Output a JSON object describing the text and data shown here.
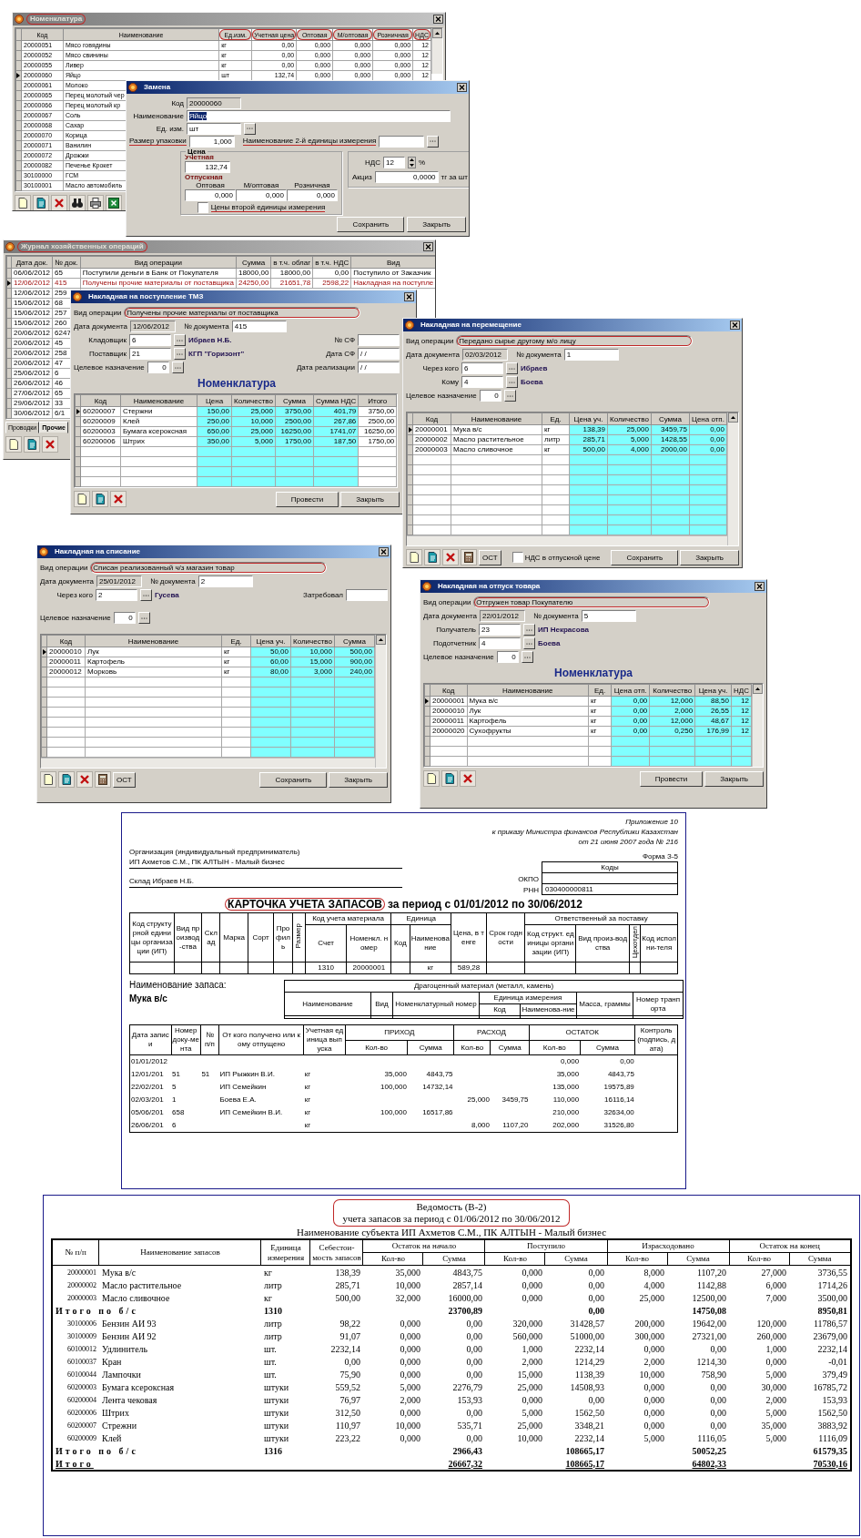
{
  "windows": [
    {
      "kind": "catalog",
      "title": "Номенклатура",
      "title_circled": true,
      "active": false,
      "table": {
        "columns": [
          {
            "label": "Код"
          },
          {
            "label": "Наименование"
          },
          {
            "label": "Ед.изм.",
            "circled": true
          },
          {
            "label": "Учетная цена",
            "circled": true
          },
          {
            "label": "Оптовая",
            "circled": true
          },
          {
            "label": "М/оптовая",
            "circled": true
          },
          {
            "label": "Розничная",
            "circled": true
          },
          {
            "label": "НДС",
            "circled": true
          }
        ],
        "rows": [
          {
            "selected": false,
            "cells": [
              "20000051",
              "Мясо говядины",
              "кг",
              "0,00",
              "0,000",
              "0,000",
              "0,000",
              "12"
            ]
          },
          {
            "selected": false,
            "cells": [
              "20000052",
              "Мясо свинины",
              "кг",
              "0,00",
              "0,000",
              "0,000",
              "0,000",
              "12"
            ]
          },
          {
            "selected": false,
            "cells": [
              "20000055",
              "Ливер",
              "кг",
              "0,00",
              "0,000",
              "0,000",
              "0,000",
              "12"
            ]
          },
          {
            "selected": true,
            "cells": [
              "20000060",
              "Яйцо",
              "шт",
              "132,74",
              "0,000",
              "0,000",
              "0,000",
              "12"
            ]
          },
          {
            "selected": false,
            "cells": [
              "20000061",
              "Молоко"
            ]
          },
          {
            "selected": false,
            "cells": [
              "20000065",
              "Перец молотый чер"
            ]
          },
          {
            "selected": false,
            "cells": [
              "20000066",
              "Перец молотый кр"
            ]
          },
          {
            "selected": false,
            "cells": [
              "20000067",
              "Соль"
            ]
          },
          {
            "selected": false,
            "cells": [
              "20000068",
              "Сахар"
            ]
          },
          {
            "selected": false,
            "cells": [
              "20000070",
              "Корица"
            ]
          },
          {
            "selected": false,
            "cells": [
              "20000071",
              "Ванилин"
            ]
          },
          {
            "selected": false,
            "cells": [
              "20000072",
              "Дрожжи"
            ]
          },
          {
            "selected": false,
            "cells": [
              "20000082",
              "Печенье Крокет"
            ]
          },
          {
            "selected": false,
            "cells": [
              "30100000",
              "ГСМ"
            ]
          },
          {
            "selected": false,
            "cells": [
              "30100001",
              "Масло автомобиль"
            ]
          }
        ]
      }
    },
    {
      "kind": "replace",
      "title": "Замена",
      "active": true,
      "code": {
        "label": "Код",
        "value": "20000060",
        "disabled": true
      },
      "name": {
        "label": "Наименование",
        "value": "Яйцо",
        "text_selected": true
      },
      "unit": {
        "label": "Ед. изм.",
        "value": "шт"
      },
      "pack": {
        "label": "Размер упаковки",
        "value": "1,000",
        "underlined": true
      },
      "unit2": {
        "label": "Наименование 2-й единицы измерения",
        "underlined": true
      },
      "price": {
        "legend": "Цена",
        "account_label": "Учетная",
        "account_value": "132,74",
        "sale_label": "Отпускная",
        "sale": [
          {
            "label": "Оптовая",
            "value": "0,000"
          },
          {
            "label": "М/оптовая",
            "value": "0,000"
          },
          {
            "label": "Розничная",
            "value": "0,000"
          }
        ],
        "checkbox": {
          "label": "Цены второй единицы измерения",
          "checked": false,
          "underlined": true
        }
      },
      "vat": {
        "label": "НДС",
        "value": "12",
        "unit": "%"
      },
      "excise": {
        "label": "Акциз",
        "value": "0,0000",
        "unit": "тг за шт"
      },
      "buttons": [
        "Сохранить",
        "Закрыть"
      ]
    },
    {
      "kind": "journal",
      "title": "Журнал хозяйственных операций",
      "title_circled": true,
      "active": false,
      "table": {
        "columns": [
          "Дата док.",
          "№ док.",
          "Вид операции",
          "Сумма",
          "в т.ч. облаг",
          "в т.ч. НДС",
          "Вид"
        ],
        "rows": [
          {
            "selected": false,
            "cells": [
              "06/06/2012",
              "65",
              "Поступили деньги в Банк от Покупателя",
              "18000,00",
              "18000,00",
              "0,00",
              "Поступило от Заказчик"
            ]
          },
          {
            "selected": true,
            "cells": [
              "12/06/2012",
              "415",
              "Получены прочие материалы от поставщика",
              "24250,00",
              "21651,78",
              "2598,22",
              "Накладная на поступле"
            ]
          },
          {
            "selected": false,
            "cells": [
              "12/06/2012",
              "259"
            ]
          },
          {
            "selected": false,
            "cells": [
              "15/06/2012",
              "68"
            ]
          },
          {
            "selected": false,
            "cells": [
              "15/06/2012",
              "257"
            ]
          },
          {
            "selected": false,
            "cells": [
              "15/06/2012",
              "260"
            ]
          },
          {
            "selected": false,
            "cells": [
              "20/06/2012",
              "6247"
            ]
          },
          {
            "selected": false,
            "cells": [
              "20/06/2012",
              "45"
            ]
          },
          {
            "selected": false,
            "cells": [
              "20/06/2012",
              "258"
            ]
          },
          {
            "selected": false,
            "cells": [
              "20/06/2012",
              "47"
            ]
          },
          {
            "selected": false,
            "cells": [
              "25/06/2012",
              "6"
            ]
          },
          {
            "selected": false,
            "cells": [
              "26/06/2012",
              "46"
            ]
          },
          {
            "selected": false,
            "cells": [
              "27/06/2012",
              "65"
            ]
          },
          {
            "selected": false,
            "cells": [
              "29/06/2012",
              "33"
            ]
          },
          {
            "selected": false,
            "cells": [
              "30/06/2012",
              "6/1"
            ]
          }
        ]
      },
      "tabs": [
        {
          "label": "Проводки",
          "selected": false
        },
        {
          "label": "Прочие",
          "selected": true
        }
      ]
    },
    {
      "kind": "receipt",
      "title": "Накладная на поступление ТМЗ",
      "active": true,
      "operation": {
        "label": "Вид операции",
        "value": "Получены прочие материалы от поставщика",
        "circled": true
      },
      "date": {
        "label": "Дата документа",
        "value": "12/06/2012"
      },
      "number": {
        "label": "№ документа",
        "value": "415"
      },
      "people": [
        {
          "label": "Кладовщик",
          "code": "6",
          "name": "Ибраев Н.Б."
        },
        {
          "label": "Поставщик",
          "code": "21",
          "name": "КГП \"Горизонт\""
        }
      ],
      "purpose": {
        "label": "Целевое назначение",
        "value": "0"
      },
      "extra": [
        {
          "label": "№ СФ"
        },
        {
          "label": "Дата СФ",
          "value": "/ /"
        },
        {
          "label": "Дата реализации",
          "value": "/ /"
        }
      ],
      "heading": "Номенклатура",
      "table": {
        "columns": [
          "Код",
          "Наименование",
          "Цена",
          "Количество",
          "Сумма",
          "Сумма НДС",
          "Итого"
        ],
        "rows": [
          {
            "selected": true,
            "cells": [
              "60200007",
              "Стержни",
              "150,00",
              "25,000",
              "3750,00",
              "401,79",
              "3750,00"
            ]
          },
          {
            "selected": false,
            "cells": [
              "60200009",
              "Клей",
              "250,00",
              "10,000",
              "2500,00",
              "267,86",
              "2500,00"
            ]
          },
          {
            "selected": false,
            "cells": [
              "60200003",
              "Бумага ксероксная",
              "650,00",
              "25,000",
              "16250,00",
              "1741,07",
              "16250,00"
            ]
          },
          {
            "selected": false,
            "cells": [
              "60200006",
              "Штрих",
              "350,00",
              "5,000",
              "1750,00",
              "187,50",
              "1750,00"
            ]
          }
        ]
      },
      "buttons": [
        "Провести",
        "Закрыть"
      ]
    },
    {
      "kind": "transfer",
      "title": "Накладная на перемещение",
      "active": true,
      "operation": {
        "label": "Вид операции",
        "value": "Передано сырье другому м/о лицу",
        "circled": true
      },
      "date": {
        "label": "Дата документа",
        "value": "02/03/2012"
      },
      "number": {
        "label": "№ документа",
        "value": "1"
      },
      "people": [
        {
          "label": "Через кого",
          "code": "6",
          "name": "Ибраев"
        },
        {
          "label": "Кому",
          "code": "4",
          "name": "Боева"
        }
      ],
      "purpose": {
        "label": "Целевое назначение",
        "value": "0"
      },
      "table": {
        "columns": [
          "Код",
          "Наименование",
          "Ед.",
          "Цена уч.",
          "Количество",
          "Сумма",
          "Цена отп."
        ],
        "rows": [
          {
            "selected": true,
            "cells": [
              "20000001",
              "Мука в/с",
              "кг",
              "138,39",
              "25,000",
              "3459,75",
              "0,00"
            ]
          },
          {
            "selected": false,
            "cells": [
              "20000002",
              "Масло растительное",
              "литр",
              "285,71",
              "5,000",
              "1428,55",
              "0,00"
            ]
          },
          {
            "selected": false,
            "cells": [
              "20000003",
              "Масло сливочное",
              "кг",
              "500,00",
              "4,000",
              "2000,00",
              "0,00"
            ]
          }
        ]
      },
      "ost_button": "ОСТ",
      "checkbox": {
        "label": "НДС в отпускной цене",
        "checked": false
      },
      "buttons": [
        "Сохранить",
        "Закрыть"
      ]
    },
    {
      "kind": "writeoff",
      "title": "Накладная на списание",
      "active": true,
      "operation": {
        "label": "Вид операции",
        "value": "Списан реализованный ч/з магазин товар",
        "circled": true
      },
      "date": {
        "label": "Дата документа",
        "value": "25/01/2012"
      },
      "number": {
        "label": "№ документа",
        "value": "2"
      },
      "people": [
        {
          "label": "Через кого",
          "code": "2",
          "name": "Гусева"
        }
      ],
      "purpose": {
        "label": "Целевое назначение",
        "value": "0"
      },
      "extra": [
        {
          "label": "Затребовал"
        }
      ],
      "table": {
        "columns": [
          "Код",
          "Наименование",
          "Ед.",
          "Цена уч.",
          "Количество",
          "Сумма"
        ],
        "rows": [
          {
            "selected": true,
            "cells": [
              "20000010",
              "Лук",
              "кг",
              "50,00",
              "10,000",
              "500,00"
            ]
          },
          {
            "selected": false,
            "cells": [
              "20000011",
              "Картофель",
              "кг",
              "60,00",
              "15,000",
              "900,00"
            ]
          },
          {
            "selected": false,
            "cells": [
              "20000012",
              "Морковь",
              "кг",
              "80,00",
              "3,000",
              "240,00"
            ]
          }
        ]
      },
      "ost_button": "ОСТ",
      "buttons": [
        "Сохранить",
        "Закрыть"
      ]
    },
    {
      "kind": "issue",
      "title": "Накладная на отпуск товара",
      "active": true,
      "operation": {
        "label": "Вид операции",
        "value": "Отгружен товар Покупателю",
        "circled": true
      },
      "date": {
        "label": "Дата документа",
        "value": "22/01/2012"
      },
      "number": {
        "label": "№ документа",
        "value": "5"
      },
      "people": [
        {
          "label": "Получатель",
          "code": "23",
          "name": "ИП Некрасова"
        },
        {
          "label": "Подотчетник",
          "code": "4",
          "name": "Боева"
        }
      ],
      "purpose": {
        "label": "Целевое назначение",
        "value": "0"
      },
      "heading": "Номенклатура",
      "table": {
        "columns": [
          "Код",
          "Наименование",
          "Ед.",
          "Цена отп.",
          "Количество",
          "Цена уч.",
          "НДС"
        ],
        "rows": [
          {
            "selected": true,
            "cells": [
              "20000001",
              "Мука в/с",
              "кг",
              "0,00",
              "12,000",
              "88,50",
              "12"
            ]
          },
          {
            "selected": false,
            "cells": [
              "20000010",
              "Лук",
              "кг",
              "0,00",
              "2,000",
              "26,55",
              "12"
            ]
          },
          {
            "selected": false,
            "cells": [
              "20000011",
              "Картофель",
              "кг",
              "0,00",
              "12,000",
              "48,67",
              "12"
            ]
          },
          {
            "selected": false,
            "cells": [
              "20000020",
              "Сухофрукты",
              "кг",
              "0,00",
              "0,250",
              "176,99",
              "12"
            ]
          }
        ]
      },
      "buttons": [
        "Провести",
        "Закрыть"
      ]
    }
  ],
  "inventory_card": {
    "appendix": [
      "Приложение 10",
      "к приказу Министра финансов Республики Казахстан",
      "от 21 июня 2007 года № 216"
    ],
    "form": "Форма З-5",
    "org_label": "Организация (индивидуальный предприниматель)",
    "org_name": "ИП Ахметов С.М., ПК АЛТЫН - Малый бизнес",
    "warehouse": "Склад Ибраев Н.Б.",
    "codes_title": "Коды",
    "codes": [
      {
        "label": "ОКПО"
      },
      {
        "label": "РНН",
        "value": "030400000811"
      }
    ],
    "title": "КАРТОЧКА УЧЕТА ЗАПАСОВ",
    "title_circled": true,
    "period": "за период с 01/01/2012 по 30/06/2012",
    "material_headers": [
      "Код структурной единицы организации (ИП)",
      "Вид производ-ства",
      "Склад",
      "Марка",
      "Сорт",
      "Профиль",
      "Размер",
      "Код учета материала",
      "Единица",
      "Цена, в тенге",
      "Срок годности",
      "Ответственный за поставку",
      "Счет",
      "Номенкл. номер",
      "Код",
      "Наименование",
      "Код структ. единицы организации (ИП)",
      "Вид произ-водства",
      "Цехотдел",
      "Код исполни-теля"
    ],
    "material_row": {
      "account": "1310",
      "number": "20000001",
      "unit": "кг",
      "price": "589,28"
    },
    "item_label": "Наименование запаса:",
    "item_name": "Мука в/с",
    "precious_headers": [
      "Драгоценный материал (металл, камень)",
      "Наименование",
      "Вид",
      "Номенклатурный номер",
      "Единица измерения",
      "Код",
      "Наименова-ние",
      "Масса, граммы",
      "Номер транпорта"
    ],
    "movement_headers": [
      "Дата записи",
      "Номер доку-мента",
      "№ п/п",
      "От кого получено или кому отпущено",
      "Учетная единица выпуска",
      "ПРИХОД",
      "Кол-во",
      "Сумма",
      "РАСХОД",
      "Кол-во",
      "Сумма",
      "ОСТАТОК",
      "Кол-во",
      "Сумма",
      "Контроль (подпись, дата)"
    ],
    "movements": [
      {
        "date": "01/01/2012",
        "bal_qty": "0,000",
        "bal_sum": "0,00"
      },
      {
        "date": "12/01/201",
        "doc": "51",
        "no": "51",
        "party": "ИП Рыжкин В.И.",
        "unit": "кг",
        "in_qty": "35,000",
        "in_sum": "4843,75",
        "bal_qty": "35,000",
        "bal_sum": "4843,75"
      },
      {
        "date": "22/02/201",
        "doc": "5",
        "party": "ИП Семейкин",
        "unit": "кг",
        "in_qty": "100,000",
        "in_sum": "14732,14",
        "bal_qty": "135,000",
        "bal_sum": "19575,89"
      },
      {
        "date": "02/03/201",
        "doc": "1",
        "party": "Боева Е.А.",
        "unit": "кг",
        "out_qty": "25,000",
        "out_sum": "3459,75",
        "bal_qty": "110,000",
        "bal_sum": "16116,14"
      },
      {
        "date": "05/06/201",
        "doc": "658",
        "party": "ИП Семейкин В.И.",
        "unit": "кг",
        "in_qty": "100,000",
        "in_sum": "16517,86",
        "bal_qty": "210,000",
        "bal_sum": "32634,00"
      },
      {
        "date": "26/06/201",
        "doc": "6",
        "unit": "кг",
        "out_qty": "8,000",
        "out_sum": "1107,20",
        "bal_qty": "202,000",
        "bal_sum": "31526,80"
      }
    ]
  },
  "ledger": {
    "title": "Ведомость (В-2)",
    "subtitle": "учета запасов за период с 01/06/2012 по 30/06/2012",
    "title_circled": true,
    "subject": "Наименование субъекта  ИП Ахметов С.М., ПК АЛТЫН - Малый бизнес",
    "headers": [
      "№ п/п",
      "Наименование запасов",
      "Единица измерения",
      "Себестои-мость запасов",
      "Остаток на начало",
      "Поступило",
      "Израсходовано",
      "Остаток на конец",
      "Кол-во",
      "Сумма",
      "Кол-во",
      "Сумма",
      "Кол-во",
      "Сумма",
      "Кол-во",
      "Сумма"
    ],
    "rows": [
      {
        "kind": "item",
        "cells": [
          "20000001",
          "Мука в/с",
          "кг",
          "138,39",
          "35,000",
          "4843,75",
          "0,000",
          "0,00",
          "8,000",
          "1107,20",
          "27,000",
          "3736,55"
        ]
      },
      {
        "kind": "item",
        "cells": [
          "20000002",
          "Масло растительное",
          "литр",
          "285,71",
          "10,000",
          "2857,14",
          "0,000",
          "0,00",
          "4,000",
          "1142,88",
          "6,000",
          "1714,26"
        ]
      },
      {
        "kind": "item",
        "cells": [
          "20000003",
          "Масло сливочное",
          "кг",
          "500,00",
          "32,000",
          "16000,00",
          "0,000",
          "0,00",
          "25,000",
          "12500,00",
          "7,000",
          "3500,00"
        ]
      },
      {
        "kind": "subtotal",
        "label": "Итого по б/с",
        "account": "1310",
        "sums": [
          "23700,89",
          "0,00",
          "14750,08",
          "8950,81"
        ]
      },
      {
        "kind": "item",
        "cells": [
          "30100006",
          "Бензин АИ 93",
          "литр",
          "98,22",
          "0,000",
          "0,00",
          "320,000",
          "31428,57",
          "200,000",
          "19642,00",
          "120,000",
          "11786,57"
        ]
      },
      {
        "kind": "item",
        "cells": [
          "30100009",
          "Бензин АИ 92",
          "литр",
          "91,07",
          "0,000",
          "0,00",
          "560,000",
          "51000,00",
          "300,000",
          "27321,00",
          "260,000",
          "23679,00"
        ]
      },
      {
        "kind": "item",
        "cells": [
          "60100012",
          "Удлинитель",
          "шт.",
          "2232,14",
          "0,000",
          "0,00",
          "1,000",
          "2232,14",
          "0,000",
          "0,00",
          "1,000",
          "2232,14"
        ]
      },
      {
        "kind": "item",
        "cells": [
          "60100037",
          "Кран",
          "шт.",
          "0,00",
          "0,000",
          "0,00",
          "2,000",
          "1214,29",
          "2,000",
          "1214,30",
          "0,000",
          "-0,01"
        ]
      },
      {
        "kind": "item",
        "cells": [
          "60100044",
          "Лампочки",
          "шт.",
          "75,90",
          "0,000",
          "0,00",
          "15,000",
          "1138,39",
          "10,000",
          "758,90",
          "5,000",
          "379,49"
        ]
      },
      {
        "kind": "item",
        "cells": [
          "60200003",
          "Бумага ксероксная",
          "штуки",
          "559,52",
          "5,000",
          "2276,79",
          "25,000",
          "14508,93",
          "0,000",
          "0,00",
          "30,000",
          "16785,72"
        ]
      },
      {
        "kind": "item",
        "cells": [
          "60200004",
          "Лента чековая",
          "штуки",
          "76,97",
          "2,000",
          "153,93",
          "0,000",
          "0,00",
          "0,000",
          "0,00",
          "2,000",
          "153,93"
        ]
      },
      {
        "kind": "item",
        "cells": [
          "60200006",
          "Штрих",
          "штуки",
          "312,50",
          "0,000",
          "0,00",
          "5,000",
          "1562,50",
          "0,000",
          "0,00",
          "5,000",
          "1562,50"
        ]
      },
      {
        "kind": "item",
        "cells": [
          "60200007",
          "Стрежни",
          "штуки",
          "110,97",
          "10,000",
          "535,71",
          "25,000",
          "3348,21",
          "0,000",
          "0,00",
          "35,000",
          "3883,92"
        ]
      },
      {
        "kind": "item",
        "cells": [
          "60200009",
          "Клей",
          "штуки",
          "223,22",
          "0,000",
          "0,00",
          "10,000",
          "2232,14",
          "5,000",
          "1116,05",
          "5,000",
          "1116,09"
        ]
      },
      {
        "kind": "subtotal",
        "label": "Итого по б/с",
        "account": "1316",
        "sums": [
          "2966,43",
          "108665,17",
          "50052,25",
          "61579,35"
        ]
      },
      {
        "kind": "total",
        "label": "Итого",
        "sums": [
          "26667,32",
          "108665,17",
          "64802,33",
          "70530,16"
        ]
      }
    ]
  }
}
